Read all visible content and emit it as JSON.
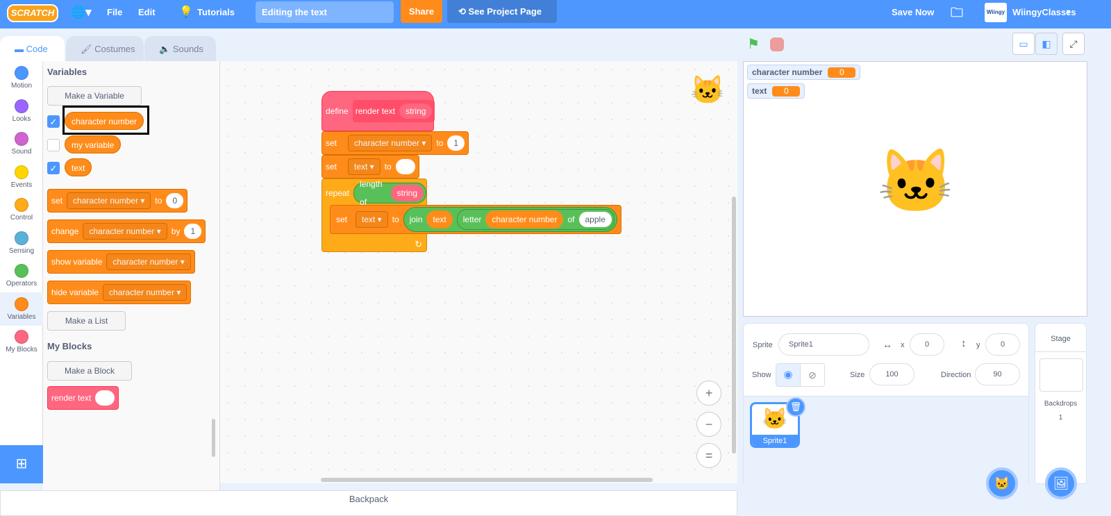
{
  "menu": {
    "logo": "SCRATCH",
    "globe": "🌐▾",
    "file": "File",
    "edit": "Edit",
    "tutorials": "Tutorials",
    "project_title": "Editing the text",
    "share": "Share",
    "see_project": "See Project Page",
    "save_now": "Save Now",
    "account": "WiingyClasses",
    "account_logo": "Wiingy"
  },
  "tabs": [
    {
      "label": "Code"
    },
    {
      "label": "Costumes"
    },
    {
      "label": "Sounds"
    }
  ],
  "categories": [
    {
      "label": "Motion",
      "color": "#4c97ff"
    },
    {
      "label": "Looks",
      "color": "#9966ff"
    },
    {
      "label": "Sound",
      "color": "#cf63cf"
    },
    {
      "label": "Events",
      "color": "#ffd500"
    },
    {
      "label": "Control",
      "color": "#ffab19"
    },
    {
      "label": "Sensing",
      "color": "#5cb1d6"
    },
    {
      "label": "Operators",
      "color": "#59c059"
    },
    {
      "label": "Variables",
      "color": "#ff8c1a"
    },
    {
      "label": "My Blocks",
      "color": "#ff6680"
    }
  ],
  "palette": {
    "variables_heading": "Variables",
    "make_variable": "Make a Variable",
    "vars": [
      {
        "name": "character number",
        "checked": true
      },
      {
        "name": "my variable",
        "checked": false
      },
      {
        "name": "text",
        "checked": true
      }
    ],
    "set_block": {
      "kw": "set",
      "var": "character number",
      "to": "to",
      "val": "0"
    },
    "change_block": {
      "kw": "change",
      "var": "character number",
      "by": "by",
      "val": "1"
    },
    "show_block": {
      "kw": "show variable",
      "var": "character number"
    },
    "hide_block": {
      "kw": "hide variable",
      "var": "character number"
    },
    "make_list": "Make a List",
    "myblocks_heading": "My Blocks",
    "make_block": "Make a Block",
    "render_block": "render text"
  },
  "script": {
    "define": "define",
    "proc": "render text",
    "param": "string",
    "set1": {
      "kw": "set",
      "var": "character number",
      "to": "to",
      "val": "1"
    },
    "set2": {
      "kw": "set",
      "var": "text",
      "to": "to",
      "val": ""
    },
    "repeat": {
      "kw": "repeat",
      "length_of": "length of",
      "arg": "string"
    },
    "set3": {
      "kw": "set",
      "var": "text",
      "to": "to",
      "join": "join",
      "join_a": "text",
      "letter": "letter",
      "letter_idx": "character number",
      "of": "of",
      "word": "apple"
    }
  },
  "zoom": {
    "in": "+",
    "out": "−",
    "reset": "="
  },
  "stage": {
    "monitors": [
      {
        "name": "character number",
        "value": "0"
      },
      {
        "name": "text",
        "value": "0"
      }
    ]
  },
  "sprite": {
    "label": "Sprite",
    "name": "Sprite1",
    "x_label": "x",
    "x": "0",
    "y_label": "y",
    "y": "0",
    "show_label": "Show",
    "size_label": "Size",
    "size": "100",
    "direction_label": "Direction",
    "direction": "90",
    "thumb_name": "Sprite1"
  },
  "stage_pane": {
    "title": "Stage",
    "backdrops_label": "Backdrops",
    "backdrops": "1"
  },
  "backpack": "Backpack",
  "colors": {
    "menubar": "#4d97ff",
    "share": "#ff8c1a",
    "variables": "#ff8c1a",
    "myblocks": "#ff6680",
    "operators": "#59c059"
  }
}
